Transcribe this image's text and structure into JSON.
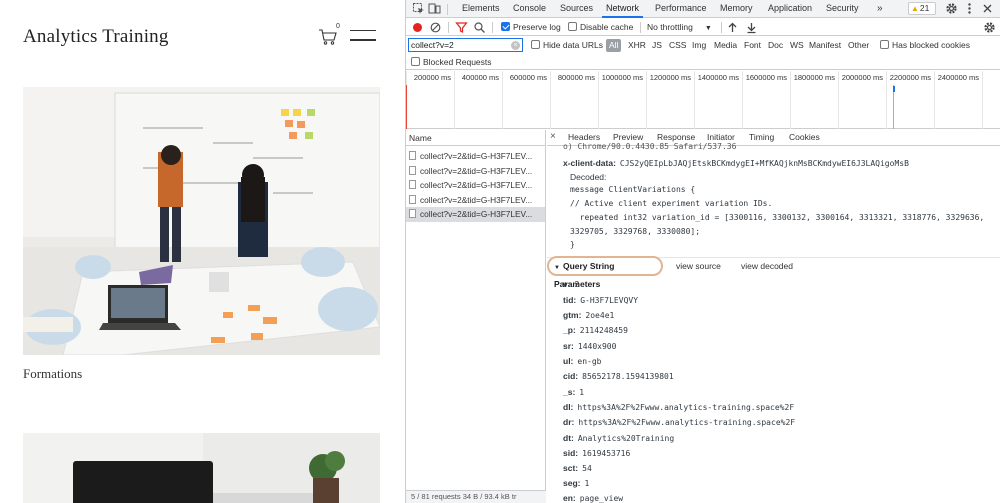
{
  "site": {
    "title": "Analytics Training",
    "cart_count": "0",
    "caption": "Formations"
  },
  "devtools": {
    "tabs": [
      "Elements",
      "Console",
      "Sources",
      "Network",
      "Performance",
      "Memory",
      "Application",
      "Security",
      "»"
    ],
    "active_tab": "Network",
    "warnings": "21",
    "toolbar": {
      "preserve_log": "Preserve log",
      "disable_cache": "Disable cache",
      "throttling": "No throttling"
    },
    "filter": {
      "value": "collect?v=2",
      "hide_data_urls": "Hide data URLs",
      "all": "All",
      "types": [
        "XHR",
        "JS",
        "CSS",
        "Img",
        "Media",
        "Font",
        "Doc",
        "WS",
        "Manifest",
        "Other"
      ],
      "blocked_cookies": "Has blocked cookies",
      "blocked_requests": "Blocked Requests"
    },
    "timeline_ticks": [
      "200000 ms",
      "400000 ms",
      "600000 ms",
      "800000 ms",
      "1000000 ms",
      "1200000 ms",
      "1400000 ms",
      "1600000 ms",
      "1800000 ms",
      "2000000 ms",
      "2200000 ms",
      "2400000 ms"
    ],
    "requests": {
      "header": "Name",
      "rows": [
        "collect?v=2&tid=G-H3F7LEV...",
        "collect?v=2&tid=G-H3F7LEV...",
        "collect?v=2&tid=G-H3F7LEV...",
        "collect?v=2&tid=G-H3F7LEV...",
        "collect?v=2&tid=G-H3F7LEV..."
      ],
      "footer": "5 / 81 requests   34 B / 93.4 kB tr"
    },
    "details": {
      "tabs": [
        "Headers",
        "Preview",
        "Response",
        "Initiator",
        "Timing",
        "Cookies"
      ],
      "cut_line": "o) Chrome/90.0.4430.85 Safari/537.36",
      "client_data_key": "x-client-data:",
      "client_data_val": "CJS2yQEIpLbJAQjEtskBCKmdygEI+MfKAQjknMsBCKmdywEI6J3LAQigoMsB",
      "decoded_label": "Decoded:",
      "code": [
        "message ClientVariations {",
        "  // Active client experiment variation IDs.",
        "  repeated int32 variation_id = [3300116, 3300132, 3300164, 3313321, 3318776, 3329636,",
        "3329705, 3329768, 3330080];",
        "}"
      ],
      "qsp_title": "Query String Parameters",
      "view_source": "view source",
      "view_decoded": "view decoded",
      "params": [
        {
          "k": "v:",
          "v": "2"
        },
        {
          "k": "tid:",
          "v": "G-H3F7LEVQVY"
        },
        {
          "k": "gtm:",
          "v": "2oe4e1"
        },
        {
          "k": "_p:",
          "v": "2114248459"
        },
        {
          "k": "sr:",
          "v": "1440x900"
        },
        {
          "k": "ul:",
          "v": "en-gb"
        },
        {
          "k": "cid:",
          "v": "85652178.1594139801"
        },
        {
          "k": "_s:",
          "v": "1"
        },
        {
          "k": "dl:",
          "v": "https%3A%2F%2Fwww.analytics-training.space%2F"
        },
        {
          "k": "dr:",
          "v": "https%3A%2F%2Fwww.analytics-training.space%2F"
        },
        {
          "k": "dt:",
          "v": "Analytics%20Training"
        },
        {
          "k": "sid:",
          "v": "1619453716"
        },
        {
          "k": "sct:",
          "v": "54"
        },
        {
          "k": "seg:",
          "v": "1"
        },
        {
          "k": "en:",
          "v": "page_view"
        }
      ]
    }
  }
}
